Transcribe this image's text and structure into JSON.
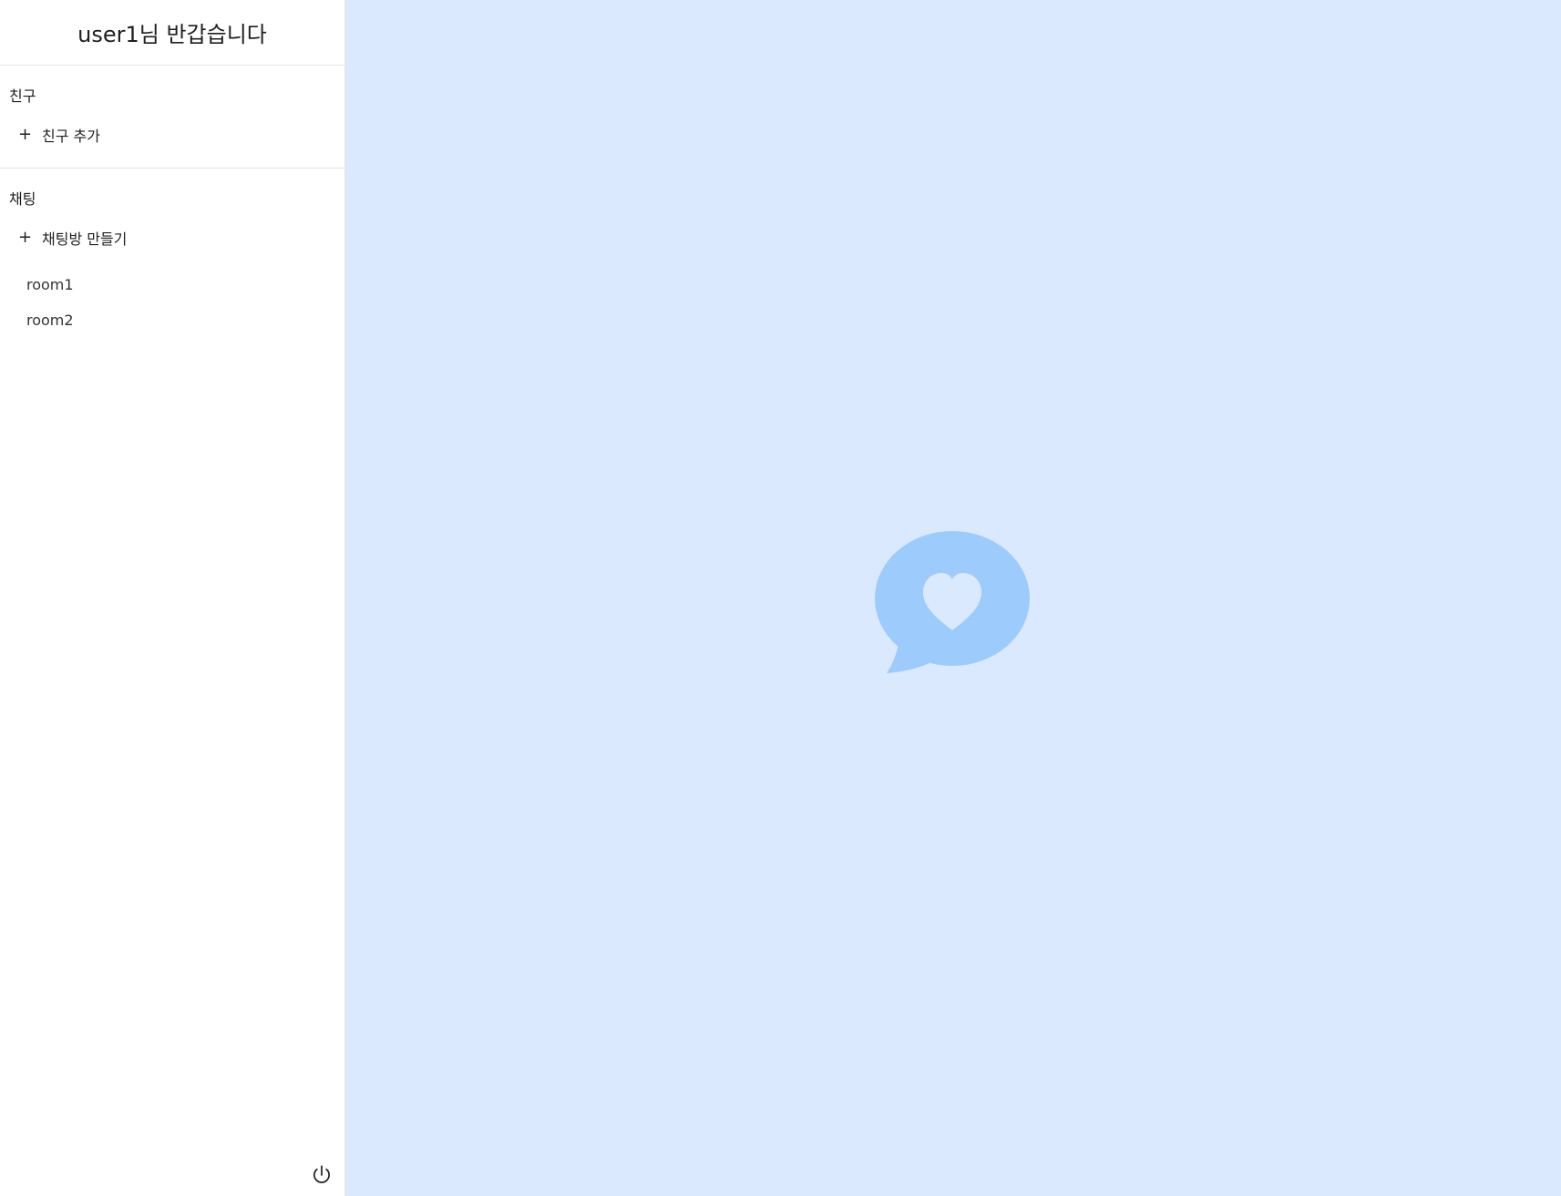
{
  "sidebar": {
    "greeting": "user1님 반갑습니다",
    "friends": {
      "title": "친구",
      "add_label": "친구 추가"
    },
    "chat": {
      "title": "채팅",
      "create_label": "채팅방 만들기",
      "rooms": [
        "room1",
        "room2"
      ]
    }
  },
  "icons": {
    "add": "plus-icon",
    "logout": "power-icon",
    "logo": "chat-bubble-heart-icon"
  },
  "colors": {
    "main_bg": "#dae9fd",
    "logo": "#9dcbfb"
  }
}
